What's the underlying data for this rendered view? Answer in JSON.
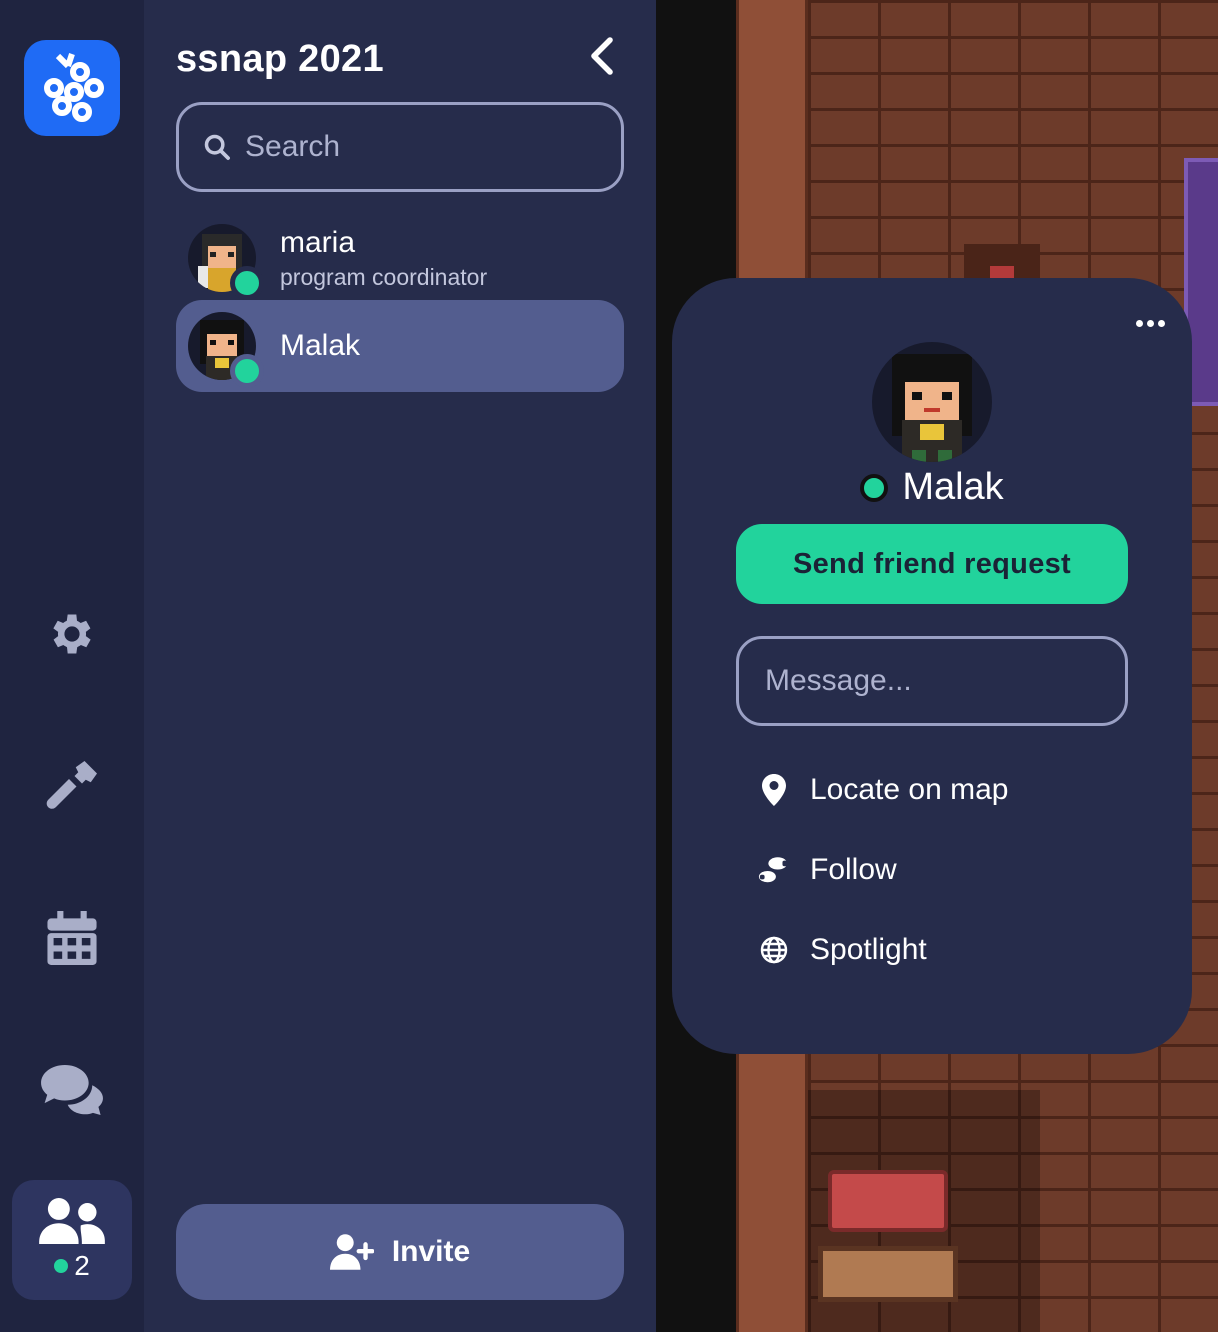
{
  "sidebar": {
    "online_count": "2",
    "items": [
      {
        "icon": "gear-icon"
      },
      {
        "icon": "hammer-icon"
      },
      {
        "icon": "calendar-icon"
      },
      {
        "icon": "chat-icon"
      },
      {
        "icon": "people-icon"
      }
    ]
  },
  "panel": {
    "title": "ssnap 2021",
    "search_placeholder": "Search",
    "members": [
      {
        "name": "maria",
        "role": "program coordinator",
        "status": "online"
      },
      {
        "name": "Malak",
        "status": "online",
        "selected": true
      }
    ],
    "invite_label": "Invite"
  },
  "profile": {
    "name": "Malak",
    "status": "online",
    "friend_button": "Send friend request",
    "message_placeholder": "Message...",
    "actions": [
      {
        "icon": "map-pin-icon",
        "label": "Locate on map"
      },
      {
        "icon": "footsteps-icon",
        "label": "Follow"
      },
      {
        "icon": "globe-icon",
        "label": "Spotlight"
      }
    ]
  },
  "colors": {
    "accent_green": "#22d39c",
    "brand_blue": "#1f6bf5",
    "panel_bg": "#262c4b",
    "rail_bg": "#1f2440",
    "selected_bg": "#535d8f"
  }
}
